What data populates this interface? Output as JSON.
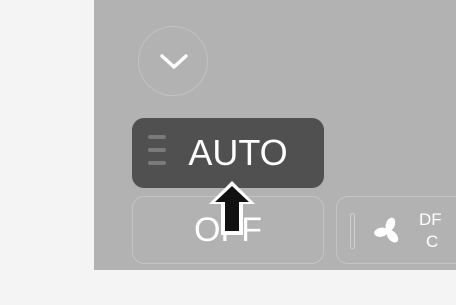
{
  "panel": {
    "collapse_button": {
      "icon": "chevron-down-icon"
    },
    "auto_button": {
      "label": "AUTO",
      "state": "active"
    },
    "off_button": {
      "label": "OFF"
    },
    "defrost_button": {
      "icon": "fan-icon",
      "label_line1": "DF",
      "label_line2": "C"
    }
  },
  "pointer": {
    "icon": "up-arrow-icon"
  },
  "colors": {
    "panel_bg": "#b2b2b2",
    "active_button_bg": "#505050",
    "label_text": "#ffffff",
    "outline": "#c4c4c4"
  }
}
